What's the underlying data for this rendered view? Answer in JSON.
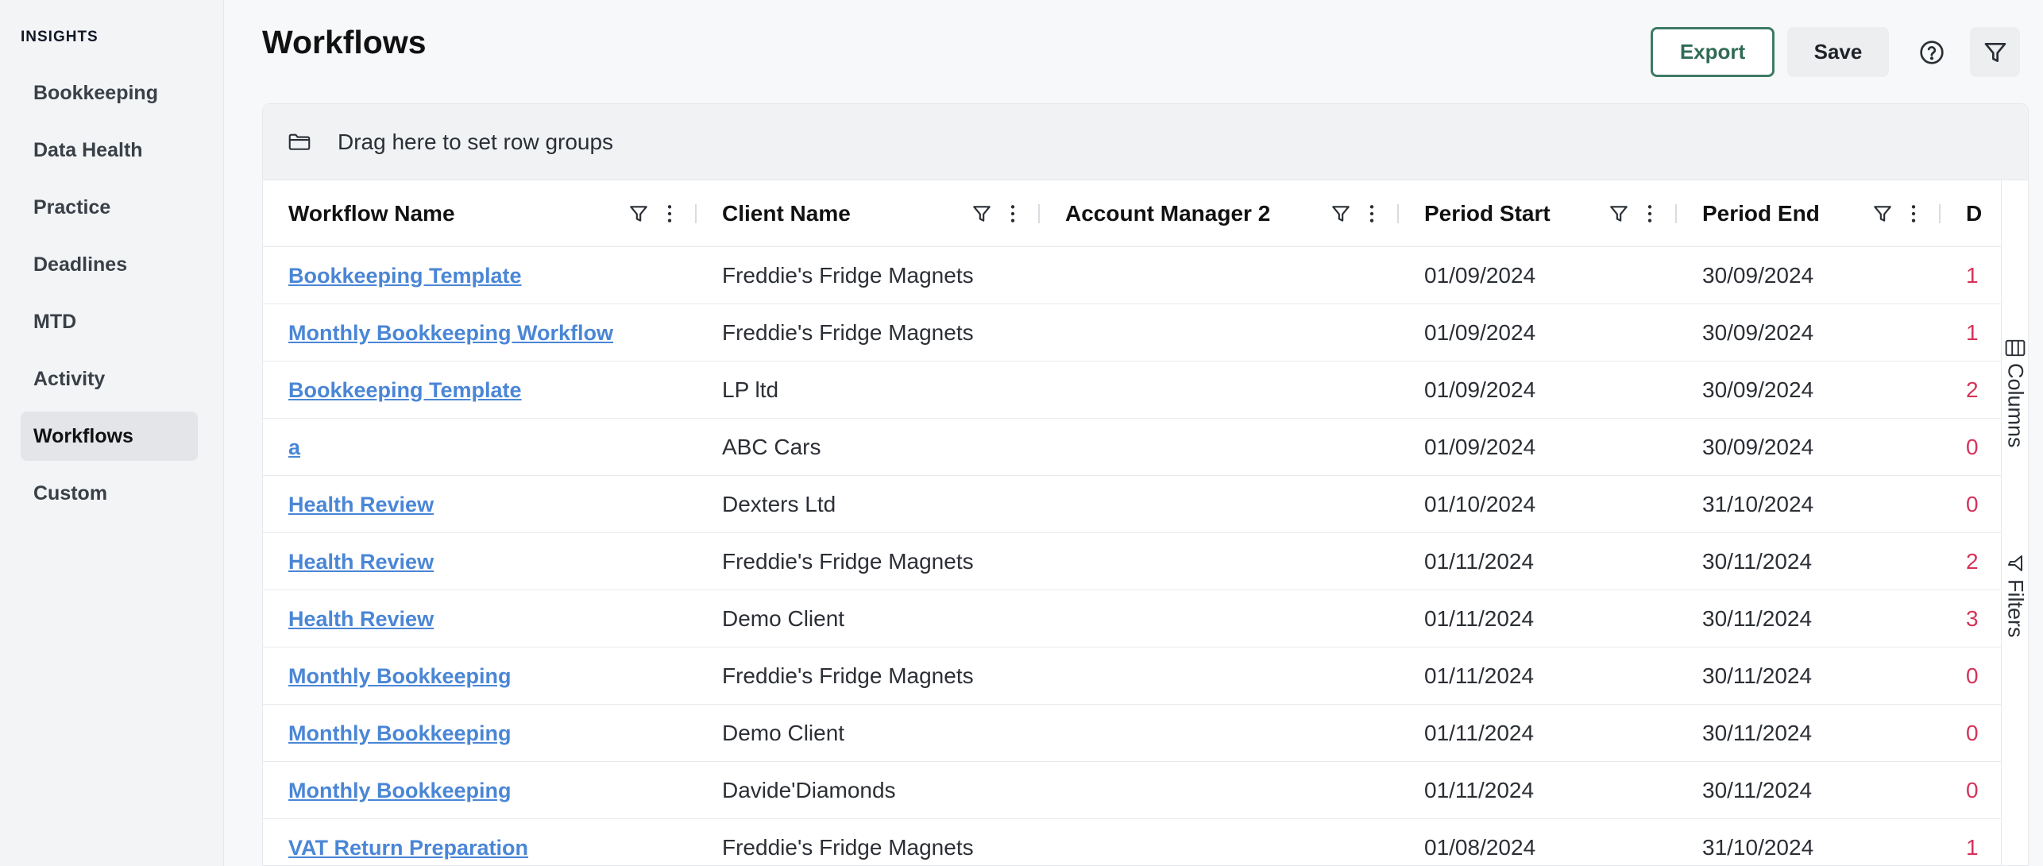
{
  "sidebar": {
    "heading": "INSIGHTS",
    "items": [
      {
        "label": "Bookkeeping",
        "active": false
      },
      {
        "label": "Data Health",
        "active": false
      },
      {
        "label": "Practice",
        "active": false
      },
      {
        "label": "Deadlines",
        "active": false
      },
      {
        "label": "MTD",
        "active": false
      },
      {
        "label": "Activity",
        "active": false
      },
      {
        "label": "Workflows",
        "active": true
      },
      {
        "label": "Custom",
        "active": false
      }
    ]
  },
  "header": {
    "title": "Workflows",
    "export_label": "Export",
    "save_label": "Save"
  },
  "grid": {
    "group_bar_text": "Drag here to set row groups",
    "columns": [
      "Workflow Name",
      "Client Name",
      "Account Manager 2",
      "Period Start",
      "Period End",
      "D"
    ],
    "rows": [
      {
        "name": "Bookkeeping Template",
        "client": "Freddie's Fridge Magnets",
        "manager": "",
        "start": "01/09/2024",
        "end": "30/09/2024",
        "extra": "1"
      },
      {
        "name": "Monthly Bookkeeping Workflow",
        "client": "Freddie's Fridge Magnets",
        "manager": "",
        "start": "01/09/2024",
        "end": "30/09/2024",
        "extra": "1"
      },
      {
        "name": "Bookkeeping Template",
        "client": "LP ltd",
        "manager": "",
        "start": "01/09/2024",
        "end": "30/09/2024",
        "extra": "2"
      },
      {
        "name": "a",
        "client": "ABC Cars",
        "manager": "",
        "start": "01/09/2024",
        "end": "30/09/2024",
        "extra": "0"
      },
      {
        "name": "Health Review",
        "client": "Dexters Ltd",
        "manager": "",
        "start": "01/10/2024",
        "end": "31/10/2024",
        "extra": "0"
      },
      {
        "name": "Health Review",
        "client": "Freddie's Fridge Magnets",
        "manager": "",
        "start": "01/11/2024",
        "end": "30/11/2024",
        "extra": "2"
      },
      {
        "name": "Health Review",
        "client": "Demo Client",
        "manager": "",
        "start": "01/11/2024",
        "end": "30/11/2024",
        "extra": "3"
      },
      {
        "name": "Monthly Bookkeeping",
        "client": "Freddie's Fridge Magnets",
        "manager": "",
        "start": "01/11/2024",
        "end": "30/11/2024",
        "extra": "0"
      },
      {
        "name": "Monthly Bookkeeping",
        "client": "Demo Client",
        "manager": "",
        "start": "01/11/2024",
        "end": "30/11/2024",
        "extra": "0"
      },
      {
        "name": "Monthly Bookkeeping",
        "client": "Davide'Diamonds",
        "manager": "",
        "start": "01/11/2024",
        "end": "30/11/2024",
        "extra": "0"
      },
      {
        "name": "VAT Return Preparation",
        "client": "Freddie's Fridge Magnets",
        "manager": "",
        "start": "01/08/2024",
        "end": "31/10/2024",
        "extra": "1"
      }
    ]
  },
  "side_panel": {
    "columns_label": "Columns",
    "filters_label": "Filters"
  },
  "icons": {
    "folder": "folder-icon",
    "help": "help-circle-icon",
    "filter": "filter-icon",
    "menu": "vertical-dots-icon",
    "columns": "columns-icon"
  },
  "colors": {
    "accent": "#3e7b66",
    "link": "#4a86d6",
    "extra_value": "#d6335a"
  }
}
